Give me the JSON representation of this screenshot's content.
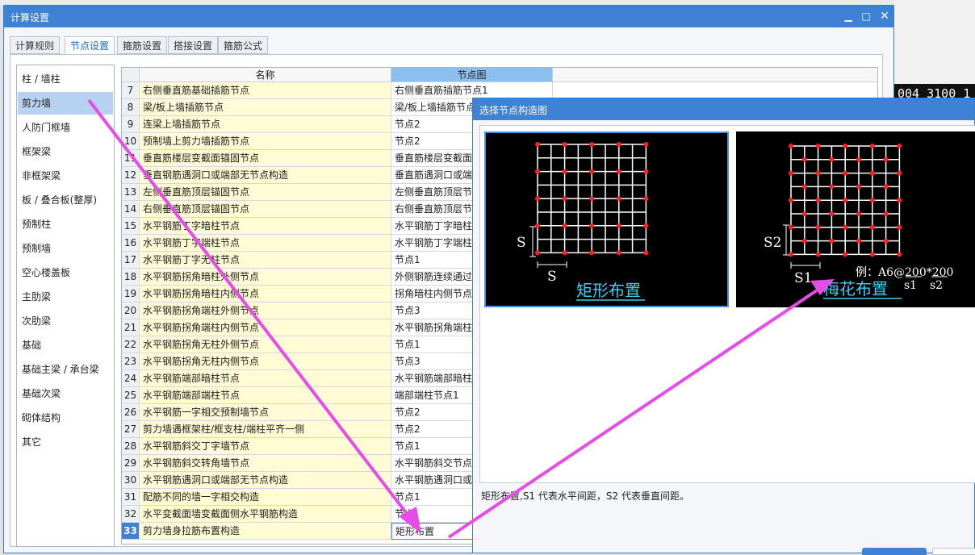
{
  "window": {
    "title": "计算设置"
  },
  "tabs": [
    "计算规则",
    "节点设置",
    "箍筋设置",
    "搭接设置",
    "箍筋公式"
  ],
  "active_tab": 1,
  "categories": [
    "柱 / 墙柱",
    "剪力墙",
    "人防门框墙",
    "框架梁",
    "非框架梁",
    "板 / 叠合板(整厚)",
    "预制柱",
    "预制墙",
    "空心楼盖板",
    "主肋梁",
    "次肋梁",
    "基础",
    "基础主梁 / 承台梁",
    "基础次梁",
    "砌体结构",
    "其它"
  ],
  "selected_category": 1,
  "grid": {
    "headers": {
      "name": "名称",
      "node": "节点图"
    },
    "rows": [
      {
        "num": "7",
        "name": "右侧垂直筋基础插筋节点",
        "node": "右侧垂直筋插筋节点1"
      },
      {
        "num": "8",
        "name": "梁/板上墙插筋节点",
        "node": "梁/板上墙插筋节点"
      },
      {
        "num": "9",
        "name": "连梁上墙插筋节点",
        "node": "节点2"
      },
      {
        "num": "10",
        "name": "预制墙上剪力墙插筋节点",
        "node": "节点2"
      },
      {
        "num": "11",
        "name": "垂直筋楼层变截面锚固节点",
        "node": "垂直筋楼层变截面"
      },
      {
        "num": "12",
        "name": "垂直钢筋遇洞口或端部无节点构造",
        "node": "垂直筋遇洞口或端"
      },
      {
        "num": "13",
        "name": "左侧垂直筋顶层锚固节点",
        "node": "左侧垂直筋顶层节"
      },
      {
        "num": "14",
        "name": "右侧垂直筋顶层锚固节点",
        "node": "右侧垂直筋顶层节"
      },
      {
        "num": "15",
        "name": "水平钢筋丁字暗柱节点",
        "node": "水平钢筋丁字暗柱"
      },
      {
        "num": "16",
        "name": "水平钢筋丁字端柱节点",
        "node": "水平钢筋丁字端柱"
      },
      {
        "num": "17",
        "name": "水平钢筋丁字无柱节点",
        "node": "节点1"
      },
      {
        "num": "18",
        "name": "水平钢筋拐角暗柱外侧节点",
        "node": "外侧钢筋连续通过"
      },
      {
        "num": "19",
        "name": "水平钢筋拐角暗柱内侧节点",
        "node": "拐角暗柱内侧节点"
      },
      {
        "num": "20",
        "name": "水平钢筋拐角端柱外侧节点",
        "node": "节点3"
      },
      {
        "num": "21",
        "name": "水平钢筋拐角端柱内侧节点",
        "node": "水平钢筋拐角端柱"
      },
      {
        "num": "22",
        "name": "水平钢筋拐角无柱外侧节点",
        "node": "节点1"
      },
      {
        "num": "23",
        "name": "水平钢筋拐角无柱内侧节点",
        "node": "节点3"
      },
      {
        "num": "24",
        "name": "水平钢筋端部暗柱节点",
        "node": "水平钢筋端部暗柱"
      },
      {
        "num": "25",
        "name": "水平钢筋端部端柱节点",
        "node": "端部端柱节点1"
      },
      {
        "num": "26",
        "name": "水平钢筋一字相交预制墙节点",
        "node": "节点2"
      },
      {
        "num": "27",
        "name": "剪力墙遇框架柱/框支柱/端柱平齐一侧",
        "node": "节点2"
      },
      {
        "num": "28",
        "name": "水平钢筋斜交丁字墙节点",
        "node": "节点1"
      },
      {
        "num": "29",
        "name": "水平钢筋斜交转角墙节点",
        "node": "水平钢筋斜交节点"
      },
      {
        "num": "30",
        "name": "水平钢筋遇洞口或端部无节点构造",
        "node": "水平钢筋遇洞口或"
      },
      {
        "num": "31",
        "name": "配筋不同的墙一字相交构造",
        "node": "节点1"
      },
      {
        "num": "32",
        "name": "水平变截面墙变截面侧水平钢筋构造",
        "node": "节点"
      },
      {
        "num": "33",
        "name": "剪力墙身拉筋布置构造",
        "node": "矩形布置"
      }
    ],
    "selected_row": 26
  },
  "dialog": {
    "title": "选择节点构造图",
    "options": [
      {
        "caption": "矩形布置",
        "dim_v": "S",
        "dim_h": "S"
      },
      {
        "caption": "梅花布置",
        "dim_v": "S2",
        "dim_h": "S1",
        "example": "例：A6@200*200",
        "example_s1": "s1",
        "example_s2": "s2"
      }
    ],
    "selected_option": 0,
    "description": "矩形布置,S1 代表水平间距，S2 代表垂直间距。"
  },
  "background": {
    "status_readout": "004  3100  1"
  },
  "colors": {
    "accent": "#3e82d6",
    "arrow": "#e64ce6",
    "rebar_dot": "#ff2020",
    "caption": "#3ad0f0"
  }
}
